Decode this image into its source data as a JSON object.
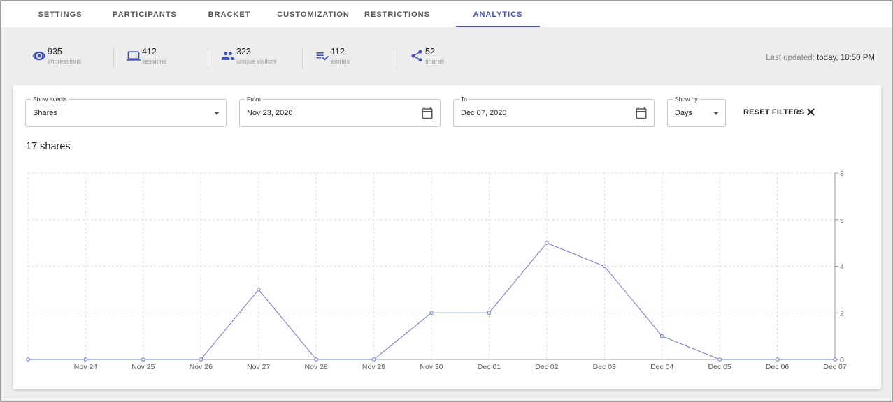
{
  "tabs": [
    {
      "label": "SETTINGS"
    },
    {
      "label": "PARTICIPANTS"
    },
    {
      "label": "BRACKET"
    },
    {
      "label": "CUSTOMIZATION"
    },
    {
      "label": "RESTRICTIONS"
    },
    {
      "label": "ANALYTICS"
    }
  ],
  "active_tab": "ANALYTICS",
  "stats": [
    {
      "icon": "eye-icon",
      "value": "935",
      "label": "impressions"
    },
    {
      "icon": "laptop-icon",
      "value": "412",
      "label": "sessions"
    },
    {
      "icon": "people-icon",
      "value": "323",
      "label": "unique visitors"
    },
    {
      "icon": "playlist-check-icon",
      "value": "112",
      "label": "entries"
    },
    {
      "icon": "share-icon",
      "value": "52",
      "label": "shares"
    }
  ],
  "last_updated": {
    "label": "Last updated:",
    "value": "today, 18:50 PM"
  },
  "filters": {
    "show_events": {
      "label": "Show events",
      "value": "Shares"
    },
    "from": {
      "label": "From",
      "value": "Nov 23, 2020"
    },
    "to": {
      "label": "To",
      "value": "Dec 07, 2020"
    },
    "show_by": {
      "label": "Show by",
      "value": "Days"
    },
    "reset_label": "RESET FILTERS"
  },
  "summary": "17 shares",
  "colors": {
    "accent": "#3f51b5",
    "line": "#6b78c4",
    "grid": "#dddddd"
  },
  "chart_data": {
    "type": "line",
    "x": [
      "",
      "Nov 24",
      "Nov 25",
      "Nov 26",
      "Nov 27",
      "Nov 28",
      "Nov 29",
      "Nov 30",
      "Dec 01",
      "Dec 02",
      "Dec 03",
      "Dec 04",
      "Dec 05",
      "Dec 06",
      "Dec 07"
    ],
    "series": [
      {
        "values": [
          0,
          0,
          0,
          0,
          3,
          0,
          0,
          2,
          2,
          5,
          4,
          1,
          0,
          0,
          0
        ]
      }
    ],
    "ylim": [
      0,
      8
    ],
    "yticks": [
      "0",
      "2",
      "4",
      "6",
      "8"
    ],
    "y_axis_side": "right",
    "grid": true,
    "title": "",
    "xlabel": "",
    "ylabel": ""
  }
}
